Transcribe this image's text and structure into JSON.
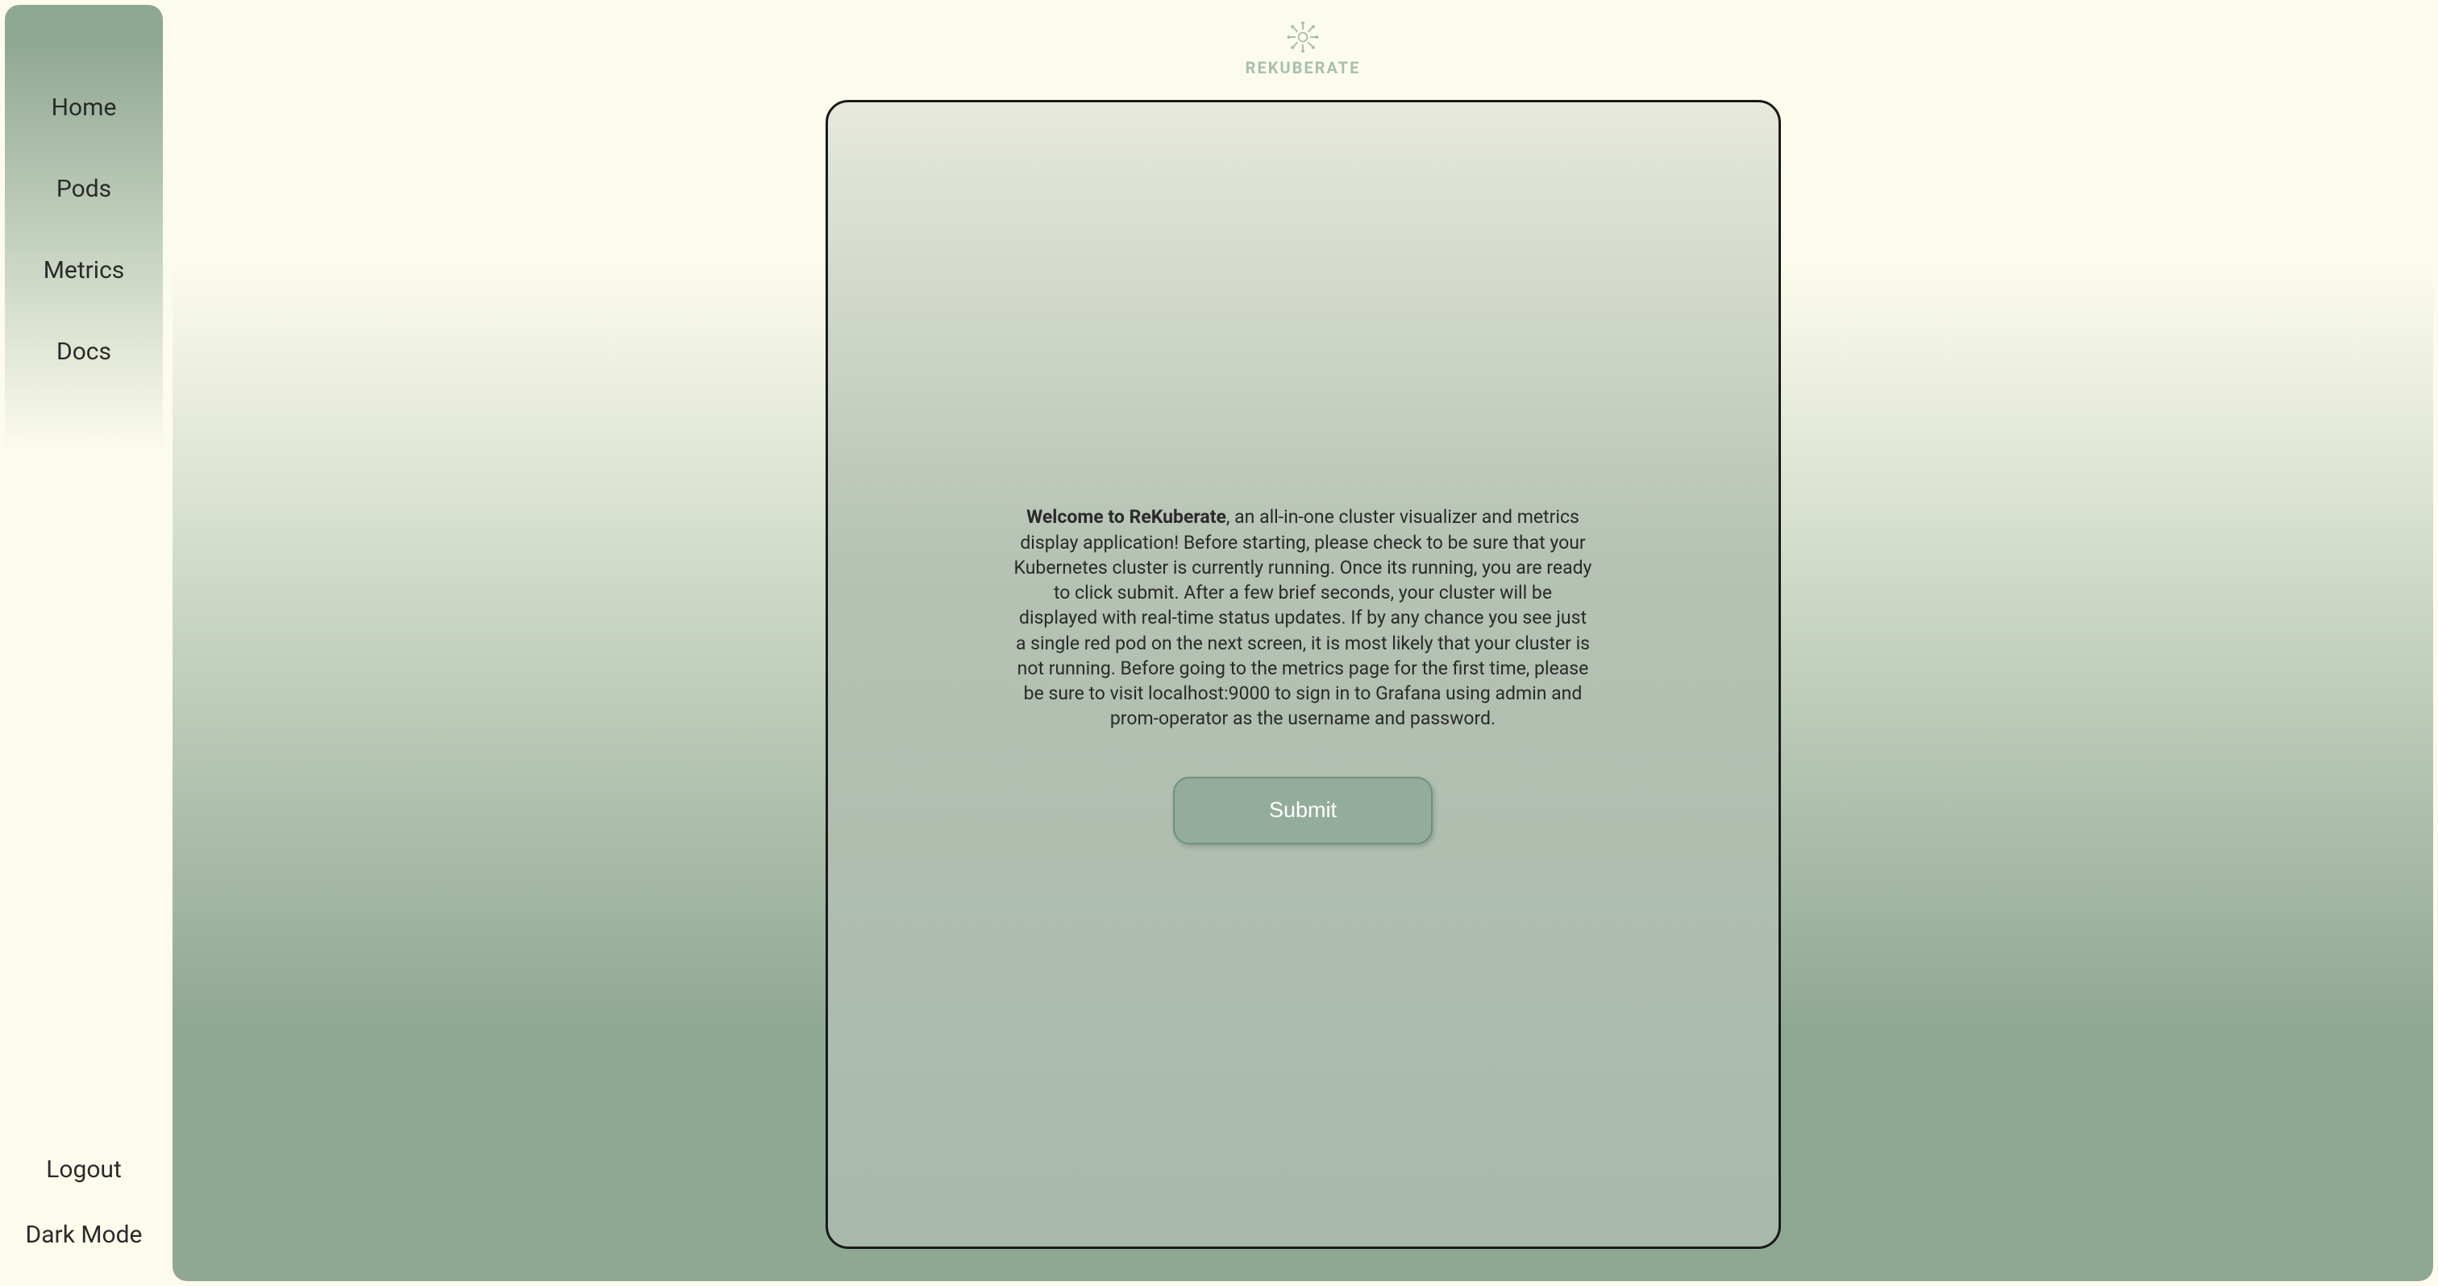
{
  "brand": {
    "name": "REKUBERATE"
  },
  "sidebar": {
    "top": [
      {
        "label": "Home"
      },
      {
        "label": "Pods"
      },
      {
        "label": "Metrics"
      },
      {
        "label": "Docs"
      }
    ],
    "bottom": [
      {
        "label": "Logout"
      },
      {
        "label": "Dark Mode"
      }
    ]
  },
  "welcome": {
    "bold": "Welcome to ReKuberate",
    "body": ", an all-in-one cluster visualizer and metrics display application! Before starting, please check to be sure that your Kubernetes cluster is currently running. Once its running, you are ready to click submit. After a few brief seconds, your cluster will be displayed with real-time status updates. If by any chance you see just a single red pod on the next screen, it is most likely that your cluster is not running. Before going to the metrics page for the first time, please be sure to visit localhost:9000 to sign in to Grafana using admin and prom-operator as the username and password."
  },
  "actions": {
    "submit_label": "Submit"
  }
}
